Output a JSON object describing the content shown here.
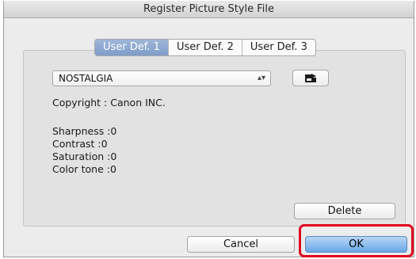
{
  "window": {
    "title": "Register Picture Style File"
  },
  "tabs": [
    {
      "label": "User Def. 1",
      "active": true
    },
    {
      "label": "User Def. 2",
      "active": false
    },
    {
      "label": "User Def. 3",
      "active": false
    }
  ],
  "style_select": {
    "value": "NOSTALGIA",
    "arrows": "⌃⌄"
  },
  "open_button": {
    "icon": "open-file-icon"
  },
  "info": {
    "copyright": "Copyright : Canon INC.",
    "sharpness": "Sharpness :0",
    "contrast": "Contrast :0",
    "saturation": "Saturation :0",
    "color_tone": "Color tone :0"
  },
  "buttons": {
    "delete": "Delete",
    "cancel": "Cancel",
    "ok": "OK"
  },
  "colors": {
    "highlight": "#e1001e",
    "tab_active": "#8aa6cf",
    "ok_button": "#6aa7e8"
  }
}
